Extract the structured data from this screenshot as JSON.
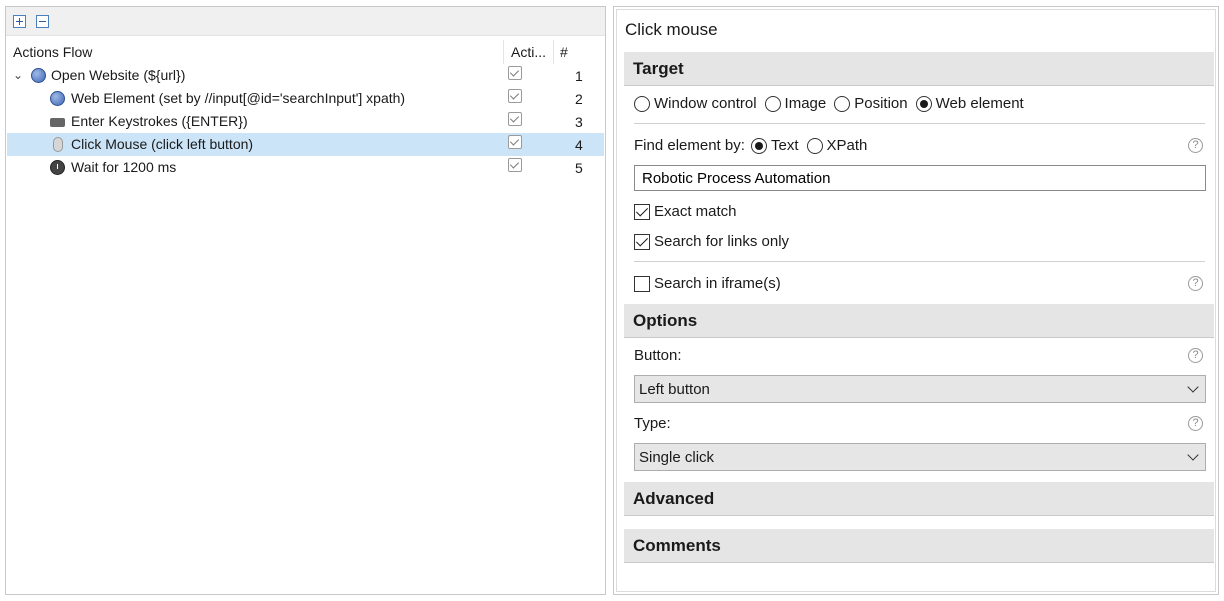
{
  "actions_flow": {
    "toolbar": {
      "expand_icon": "expand-all-icon",
      "collapse_icon": "collapse-all-icon"
    },
    "columns": {
      "name": "Actions Flow",
      "active": "Acti...",
      "number": "#"
    },
    "rows": [
      {
        "label": "Open Website (${url})",
        "icon": "globe-icon",
        "active": true,
        "number": "1",
        "expanded": true
      },
      {
        "label": "Web Element (set by //input[@id='searchInput'] xpath)",
        "icon": "globe-icon",
        "active": true,
        "number": "2"
      },
      {
        "label": "Enter Keystrokes ({ENTER})",
        "icon": "keyboard-icon",
        "active": true,
        "number": "3"
      },
      {
        "label": "Click Mouse (click left button)",
        "icon": "mouse-icon",
        "active": true,
        "number": "4",
        "selected": true
      },
      {
        "label": "Wait for 1200 ms",
        "icon": "clock-icon",
        "active": true,
        "number": "5"
      }
    ]
  },
  "properties": {
    "title": "Click mouse",
    "target": {
      "header": "Target",
      "target_types": [
        "Window control",
        "Image",
        "Position",
        "Web element"
      ],
      "selected_target": "Web element",
      "find_by_label": "Find element by:",
      "find_by_options": [
        "Text",
        "XPath"
      ],
      "find_by_selected": "Text",
      "text_value": "Robotic Process Automation",
      "exact_match": {
        "label": "Exact match",
        "checked": true
      },
      "links_only": {
        "label": "Search for links only",
        "checked": true
      },
      "iframes": {
        "label": "Search in iframe(s)",
        "checked": false
      }
    },
    "options": {
      "header": "Options",
      "button_label": "Button:",
      "button_value": "Left button",
      "type_label": "Type:",
      "type_value": "Single click"
    },
    "advanced": {
      "header": "Advanced"
    },
    "comments": {
      "header": "Comments"
    },
    "help_glyph": "?"
  },
  "colors": {
    "selection": "#cce4f7",
    "section_header": "#e5e5e5",
    "border": "#c8c8c8"
  }
}
